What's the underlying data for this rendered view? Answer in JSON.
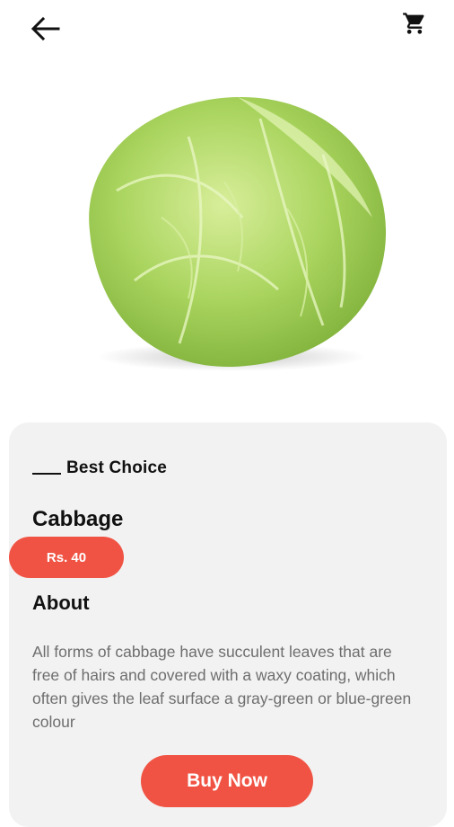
{
  "header": {
    "back_icon": "arrow-left-icon",
    "cart_icon": "shopping-cart-icon"
  },
  "product": {
    "image_subject": "cabbage",
    "eyebrow": "Best Choice",
    "name": "Cabbage",
    "price": "Rs. 40",
    "about_heading": "About",
    "description": "All forms of cabbage have succulent leaves that are free of hairs and covered with a waxy coating, which often gives the leaf surface a gray-green or blue-green colour",
    "buy_label": "Buy Now"
  },
  "colors": {
    "accent": "#f05343",
    "card_bg": "#f2f2f2",
    "text_muted": "#6e6e6e"
  }
}
